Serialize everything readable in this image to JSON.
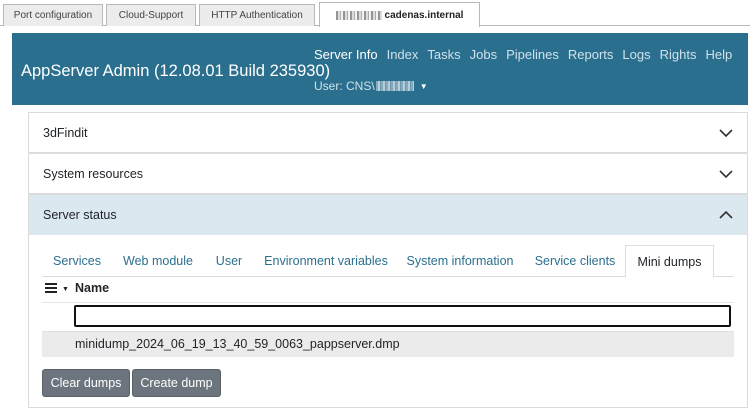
{
  "browser_tabs": [
    {
      "label": "Port configuration"
    },
    {
      "label": "Cloud-Support"
    },
    {
      "label": "HTTP Authentication"
    },
    {
      "label": "cadenas.internal"
    }
  ],
  "header": {
    "title": "AppServer Admin (12.08.01 Build 235930)",
    "nav": [
      "Server Info",
      "Index",
      "Tasks",
      "Jobs",
      "Pipelines",
      "Reports",
      "Logs",
      "Rights",
      "Help"
    ],
    "active_nav": "Server Info",
    "user_label": "User: CNS\\",
    "colors": {
      "header_bg": "#2b6f8f",
      "panel_active_bg": "#dbe8ef",
      "button_bg": "#6c757d"
    }
  },
  "panels": [
    {
      "title": "3dFindit",
      "state": "collapsed",
      "icon": "chevron-down-icon"
    },
    {
      "title": "System resources",
      "state": "collapsed",
      "icon": "chevron-down-icon"
    },
    {
      "title": "Server status",
      "state": "expanded",
      "icon": "chevron-up-icon"
    }
  ],
  "tabs": [
    {
      "label": "Services"
    },
    {
      "label": "Web module"
    },
    {
      "label": "User"
    },
    {
      "label": "Environment variables"
    },
    {
      "label": "System information"
    },
    {
      "label": "Service clients"
    },
    {
      "label": "Mini dumps"
    }
  ],
  "active_tab": "Mini dumps",
  "table": {
    "column_name": "Name",
    "filter_value": "",
    "rows": [
      {
        "name": "minidump_2024_06_19_13_40_59_0063_pappserver.dmp"
      }
    ]
  },
  "buttons": {
    "clear": "Clear dumps",
    "create": "Create dump"
  }
}
